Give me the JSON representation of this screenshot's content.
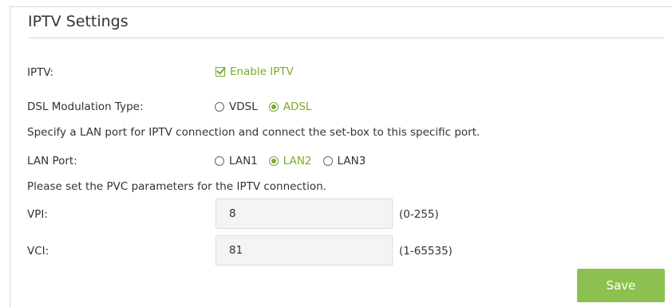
{
  "title": "IPTV Settings",
  "iptv": {
    "label": "IPTV:",
    "checkbox_label": "Enable IPTV",
    "checked": true
  },
  "dsl": {
    "label": "DSL Modulation Type:",
    "options": [
      {
        "label": "VDSL",
        "selected": false
      },
      {
        "label": "ADSL",
        "selected": true
      }
    ]
  },
  "lan_note": "Specify a LAN port for IPTV connection and connect the set-box to this specific port.",
  "lan": {
    "label": "LAN Port:",
    "options": [
      {
        "label": "LAN1",
        "selected": false
      },
      {
        "label": "LAN2",
        "selected": true
      },
      {
        "label": "LAN3",
        "selected": false
      }
    ]
  },
  "pvc_note": "Please set the PVC parameters for the IPTV connection.",
  "vpi": {
    "label": "VPI:",
    "value": "8",
    "range": "(0-255)"
  },
  "vci": {
    "label": "VCI:",
    "value": "81",
    "range": "(1-65535)"
  },
  "save_label": "Save",
  "colors": {
    "accent": "#7bab2a",
    "button": "#8cc152"
  }
}
